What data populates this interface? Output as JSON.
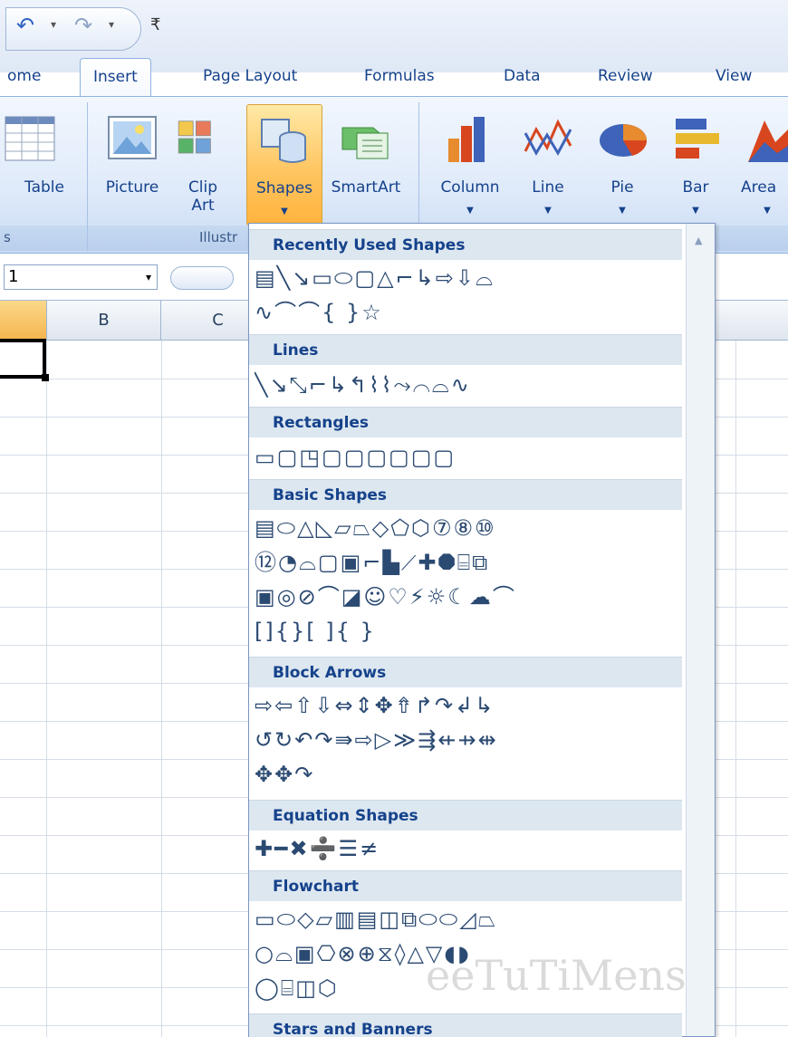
{
  "qat": {
    "undo_icon": "↶",
    "dd": "▾",
    "redo_icon": "↷",
    "customize_icon": "₹"
  },
  "tabs": [
    "ome",
    "Insert",
    "Page Layout",
    "Formulas",
    "Data",
    "Review",
    "View"
  ],
  "ribbon": {
    "buttons": [
      {
        "id": "table",
        "label": "Table",
        "arrow": ""
      },
      {
        "id": "picture",
        "label": "Picture",
        "arrow": ""
      },
      {
        "id": "clipart",
        "label": "Clip\nArt",
        "arrow": ""
      },
      {
        "id": "shapes",
        "label": "Shapes",
        "arrow": "▼"
      },
      {
        "id": "smartart",
        "label": "SmartArt",
        "arrow": ""
      },
      {
        "id": "column",
        "label": "Column",
        "arrow": "▼"
      },
      {
        "id": "line",
        "label": "Line",
        "arrow": "▼"
      },
      {
        "id": "pie",
        "label": "Pie",
        "arrow": "▼"
      },
      {
        "id": "bar",
        "label": "Bar",
        "arrow": "▼"
      },
      {
        "id": "area",
        "label": "Area",
        "arrow": "▼"
      }
    ],
    "group_labels": {
      "tables": "s",
      "illustrations": "Illustr"
    }
  },
  "namebox": {
    "value": "1",
    "dd": "▾"
  },
  "columns": [
    "B",
    "C"
  ],
  "menu": {
    "sections": [
      {
        "title": "Recently Used Shapes",
        "rows": [
          "▤╲↘▭⬭▢△⌐↳⇨⇩⌓",
          "∿⌒⌒{ }☆"
        ]
      },
      {
        "title": "Lines",
        "rows": [
          "╲↘⤡⌐↳↰⌇⌇⤳⌒⌓∿"
        ]
      },
      {
        "title": "Rectangles",
        "rows": [
          "▭▢◳▢▢▢▢▢▢"
        ]
      },
      {
        "title": "Basic Shapes",
        "rows": [
          "▤⬭△◺▱⏢◇⬠⬡⑦⑧⑩",
          "⑫◔⌓▢▣⌐▙⟋✚⯃⌸⧉",
          "▣◎⊘⌒◪☺♡⚡☼☾☁⌒",
          "[]{}[ ]{ }"
        ]
      },
      {
        "title": "Block Arrows",
        "rows": [
          "⇨⇦⇧⇩⇔⇕✥⇮↱↷↲↳",
          "↺↻↶↷⇛⇨▷≫⇶⇷⇸⇹",
          "✥✥↷"
        ]
      },
      {
        "title": "Equation Shapes",
        "rows": [
          "✚━✖➗☰≠"
        ]
      },
      {
        "title": "Flowchart",
        "rows": [
          "▭⬭◇▱▥▤◫⧉⬭⬭◿⏢",
          "○⌓▣⎔⊗⊕⧖◊△▽◖◗",
          "◯⌸◫⬡"
        ]
      },
      {
        "title": "Stars and Banners",
        "rows": []
      }
    ],
    "scroll_up": "▲"
  },
  "watermark": "eeTuTiMens"
}
